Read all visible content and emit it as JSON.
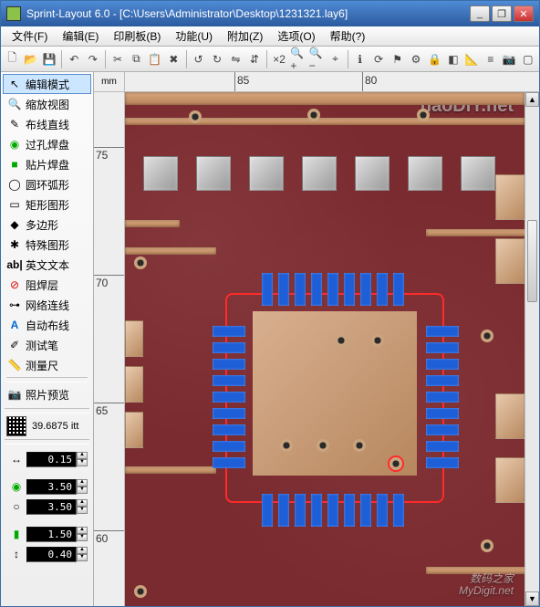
{
  "window": {
    "title": "Sprint-Layout 6.0 - [C:\\Users\\Administrator\\Desktop\\1231321.lay6]",
    "min": "_",
    "max": "❐",
    "close": "✕"
  },
  "menu": {
    "file": "文件(F)",
    "edit": "编辑(E)",
    "board": "印刷板(B)",
    "function": "功能(U)",
    "append": "附加(Z)",
    "options": "选项(O)",
    "help": "帮助(?)"
  },
  "toolbar": {
    "new": "🗋",
    "open": "📂",
    "save": "💾",
    "undo": "↶",
    "redo": "↷",
    "cut": "✂",
    "copy": "⧉",
    "paste": "📋",
    "delete": "✖",
    "rot_l": "↺",
    "rot_r": "↻",
    "mirror_h": "⇋",
    "mirror_v": "⇵",
    "zoom2": "×2",
    "zoomin": "🔍+",
    "zoomout": "🔍−",
    "reticle": "⌖",
    "info": "ℹ",
    "refresh": "⟳",
    "flag": "⚑",
    "gear": "⚙",
    "lock": "🔒",
    "view": "◧",
    "measure": "📐",
    "align": "≡",
    "camera": "📷",
    "x4": "▢"
  },
  "tools": {
    "edit": "编辑模式",
    "zoom": "缩放视图",
    "route": "布线直线",
    "pad_th": "过孔焊盘",
    "pad_smd": "贴片焊盘",
    "arc": "圆环弧形",
    "rect": "矩形图形",
    "poly": "多边形",
    "special": "特殊图形",
    "text": "英文文本",
    "mask": "阻焊层",
    "net": "网络连线",
    "auto": "自动布线",
    "test": "测试笔",
    "ruler": "测量尺",
    "photo": "照片预览"
  },
  "grid": {
    "value": "39.6875 itt"
  },
  "params": {
    "track_w": "0.15",
    "pad_o": "3.50",
    "pad_i": "3.50",
    "smd_w": "1.50",
    "smd_h": "0.40"
  },
  "ruler": {
    "unit": "mm",
    "h": [
      {
        "pos": 120,
        "label": "85"
      },
      {
        "pos": 260,
        "label": "80"
      }
    ],
    "v": [
      {
        "pos": 60,
        "label": "75"
      },
      {
        "pos": 200,
        "label": "70"
      },
      {
        "pos": 340,
        "label": "65"
      },
      {
        "pos": 480,
        "label": "60"
      }
    ]
  },
  "watermark": {
    "top": "haoDIY.net",
    "line1": "数码之家",
    "line2": "MyDigit.net"
  }
}
